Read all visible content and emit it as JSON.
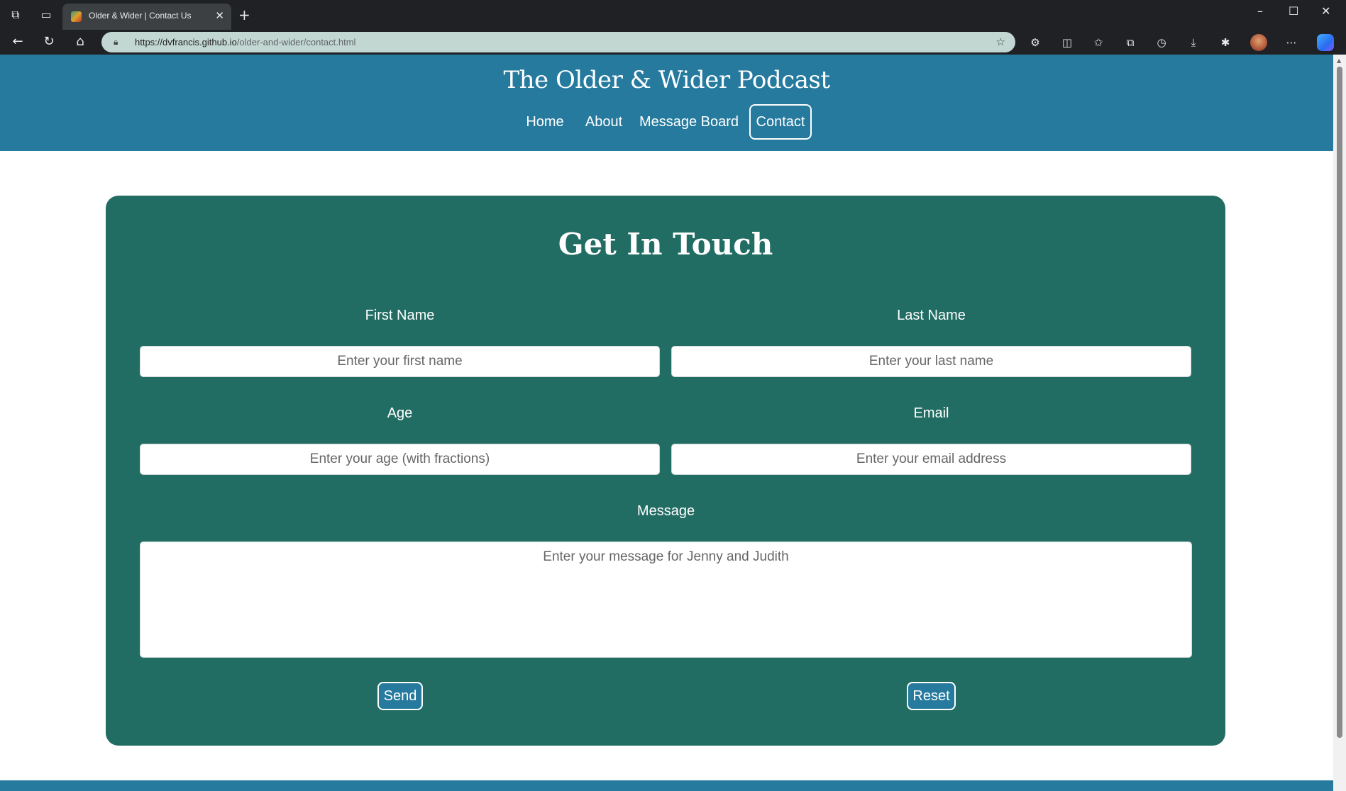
{
  "browser": {
    "tab_title": "Older & Wider | Contact Us",
    "url_host": "https://dvfrancis.github.io",
    "url_path": "/older-and-wider/contact.html",
    "icons": {
      "workspaces": "workspaces-icon",
      "tab_actions": "tab-actions-icon",
      "close_tab": "close-icon",
      "new_tab": "plus-icon",
      "minimize": "minimize-icon",
      "maximize": "maximize-icon",
      "close_window": "close-icon",
      "back": "back-arrow-icon",
      "refresh": "refresh-icon",
      "home": "home-icon",
      "lock": "lock-icon",
      "favorite": "star-icon"
    }
  },
  "site": {
    "title": "The Older & Wider Podcast",
    "nav": [
      {
        "label": "Home"
      },
      {
        "label": "About"
      },
      {
        "label": "Message Board"
      },
      {
        "label": "Contact"
      }
    ],
    "active_nav": "Contact",
    "colors": {
      "header": "#257a9e",
      "card": "#226d63",
      "white": "#ffffff"
    }
  },
  "form": {
    "heading": "Get In Touch",
    "first_name": {
      "label": "First Name",
      "placeholder": "Enter your first name",
      "value": ""
    },
    "last_name": {
      "label": "Last Name",
      "placeholder": "Enter your last name",
      "value": ""
    },
    "age": {
      "label": "Age",
      "placeholder": "Enter your age (with fractions)",
      "value": ""
    },
    "email": {
      "label": "Email",
      "placeholder": "Enter your email address",
      "value": ""
    },
    "message": {
      "label": "Message",
      "placeholder": "Enter your message for Jenny and Judith",
      "value": ""
    },
    "send_label": "Send",
    "reset_label": "Reset"
  }
}
